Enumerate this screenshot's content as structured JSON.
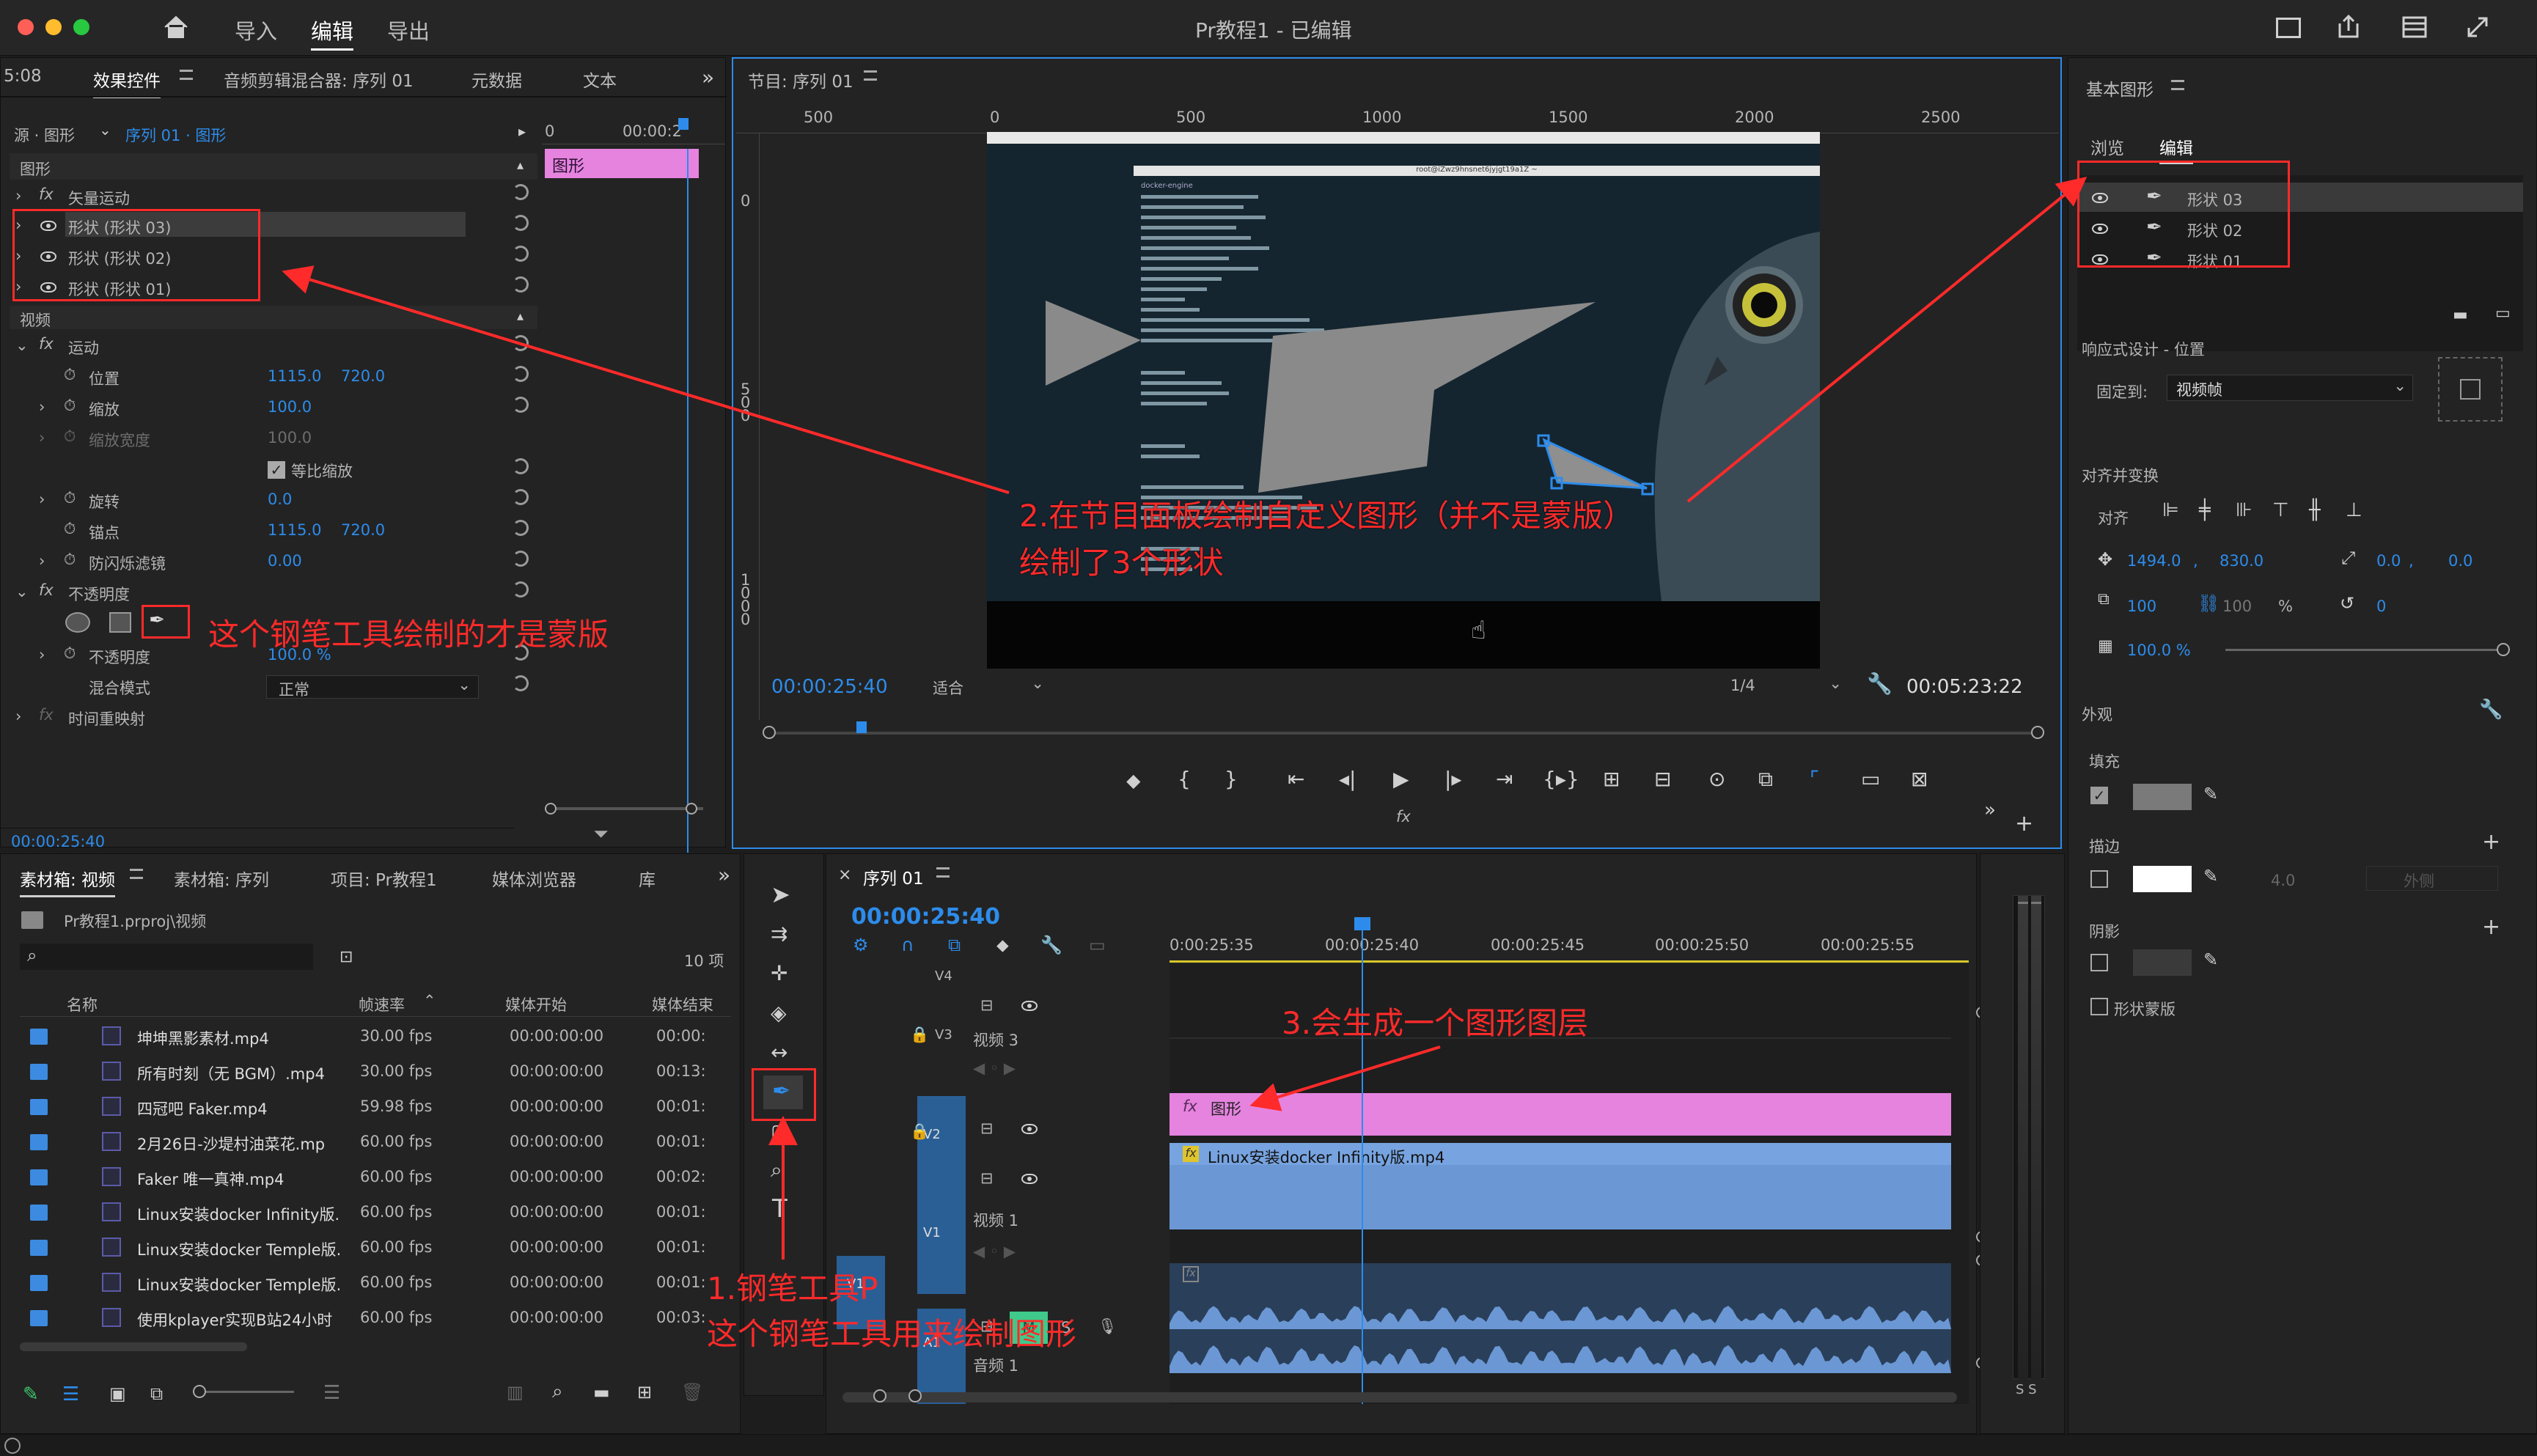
{
  "window": {
    "title": "Pr教程1 - 已编辑",
    "menu": [
      "导入",
      "编辑",
      "导出"
    ]
  },
  "effect_panel": {
    "time_left": "5:08",
    "tabs": [
      "效果控件",
      "音频剪辑混合器: 序列 01",
      "元数据",
      "文本"
    ],
    "source": "源 · 图形",
    "sequence": "序列 01 · 图形",
    "ruler_time": "00:00:2",
    "clip_label": "图形",
    "section_graphics": "图形",
    "vector_motion": "矢量运动",
    "shapes": [
      "形状 (形状 03)",
      "形状 (形状 02)",
      "形状 (形状 01)"
    ],
    "section_video": "视频",
    "motion": "运动",
    "position_label": "位置",
    "position_x": "1115.0",
    "position_y": "720.0",
    "scale_label": "缩放",
    "scale_value": "100.0",
    "scale_width_label": "缩放宽度",
    "scale_width_value": "100.0",
    "uniform_scale": "等比缩放",
    "rotation_label": "旋转",
    "rotation_value": "0.0",
    "anchor_label": "锚点",
    "anchor_x": "1115.0",
    "anchor_y": "720.0",
    "flicker_label": "防闪烁滤镜",
    "flicker_value": "0.00",
    "opacity": "不透明度",
    "opacity_label": "不透明度",
    "opacity_value": "100.0 %",
    "blend_label": "混合模式",
    "blend_value": "正常",
    "time_remap": "时间重映射",
    "timecode": "00:00:25:40"
  },
  "program": {
    "title": "节目: 序列 01",
    "ruler": [
      "500",
      "0",
      "500",
      "1000",
      "1500",
      "2000",
      "2500"
    ],
    "vruler": [
      "0",
      "5 0 0",
      "1 0 0 0"
    ],
    "timecode": "00:00:25:40",
    "fit": "适合",
    "ratio": "1/4",
    "duration": "00:05:23:22",
    "terminal_header": "docker-engine",
    "window_caption": "root@iZwz9hnsnet6jyjgt19a1Z ~"
  },
  "essential": {
    "title": "基本图形",
    "tabs": [
      "浏览",
      "编辑"
    ],
    "layers": [
      "形状 03",
      "形状 02",
      "形状 01"
    ],
    "responsive": "响应式设计 - 位置",
    "pin_label": "固定到:",
    "pin_value": "视频帧",
    "align": "对齐并变换",
    "align_label": "对齐",
    "pos_x": "1494.0",
    "pos_y": "830.0",
    "rot_x": "0.0",
    "rot_y": "0.0",
    "scale_a": "100",
    "scale_b": "100",
    "scale_pct": "%",
    "rotation": "0",
    "opacity": "100.0 %",
    "appearance": "外观",
    "fill": "填充",
    "stroke": "描边",
    "stroke_width": "4.0",
    "stroke_type": "外侧",
    "shadow": "阴影",
    "mask": "形状蒙版"
  },
  "project": {
    "tabs": [
      "素材箱: 视频",
      "素材箱: 序列",
      "项目: Pr教程1",
      "媒体浏览器",
      "库"
    ],
    "path": "Pr教程1.prproj\\视频",
    "count": "10 项",
    "columns": [
      "名称",
      "帧速率",
      "媒体开始",
      "媒体结束"
    ],
    "rows": [
      {
        "name": "坤坤黑影素材.mp4",
        "fps": "30.00 fps",
        "start": "00:00:00:00",
        "end": "00:00:"
      },
      {
        "name": "所有时刻（无 BGM）.mp4",
        "fps": "30.00 fps",
        "start": "00:00:00:00",
        "end": "00:13:"
      },
      {
        "name": "四冠吧 Faker.mp4",
        "fps": "59.98 fps",
        "start": "00:00:00:00",
        "end": "00:01:"
      },
      {
        "name": "2月26日-沙堤村油菜花.mp",
        "fps": "60.00 fps",
        "start": "00:00:00:00",
        "end": "00:01:"
      },
      {
        "name": "Faker 唯一真神.mp4",
        "fps": "60.00 fps",
        "start": "00:00:00:00",
        "end": "00:02:"
      },
      {
        "name": "Linux安装docker Infinity版.",
        "fps": "60.00 fps",
        "start": "00:00:00:00",
        "end": "00:01:"
      },
      {
        "name": "Linux安装docker Temple版.",
        "fps": "60.00 fps",
        "start": "00:00:00:00",
        "end": "00:01:"
      },
      {
        "name": "Linux安装docker Temple版.",
        "fps": "60.00 fps",
        "start": "00:00:00:00",
        "end": "00:01:"
      },
      {
        "name": "使用kplayer实现B站24小时",
        "fps": "60.00 fps",
        "start": "00:00:00:00",
        "end": "00:03:"
      }
    ]
  },
  "timeline": {
    "tab": "序列 01",
    "timecode": "00:00:25:40",
    "ruler": [
      "0:00:25:35",
      "00:00:25:40",
      "00:00:25:45",
      "00:00:25:50",
      "00:00:25:55"
    ],
    "tracks": {
      "v4": "V4",
      "v3": "V3",
      "v2": "V2",
      "v1": "V1",
      "a1": "A1"
    },
    "video3": "视频 3",
    "video1": "视频 1",
    "audio1": "音频 1",
    "graphic_clip": "图形",
    "video_clip": "Linux安装docker Infinity版.mp4",
    "m": "M",
    "s": "S"
  },
  "meter": {
    "labels": "S S"
  },
  "annotations": {
    "a1": "这个钢笔工具绘制的才是蒙版",
    "a2_line1": "2.在节目面板绘制自定义图形（并不是蒙版）",
    "a2_line2": "绘制了3个形状",
    "a3": "3.会生成一个图形图层",
    "a4_line1": "1.钢笔工具P",
    "a4_line2": "这个钢笔工具用来绘制图形"
  },
  "colors": {
    "accent": "#2d8ceb",
    "graphic_clip": "#e583df",
    "video_clip": "#6b98d4",
    "annotation": "#ff2a2a",
    "audio_clip": "#3b5f8e"
  }
}
